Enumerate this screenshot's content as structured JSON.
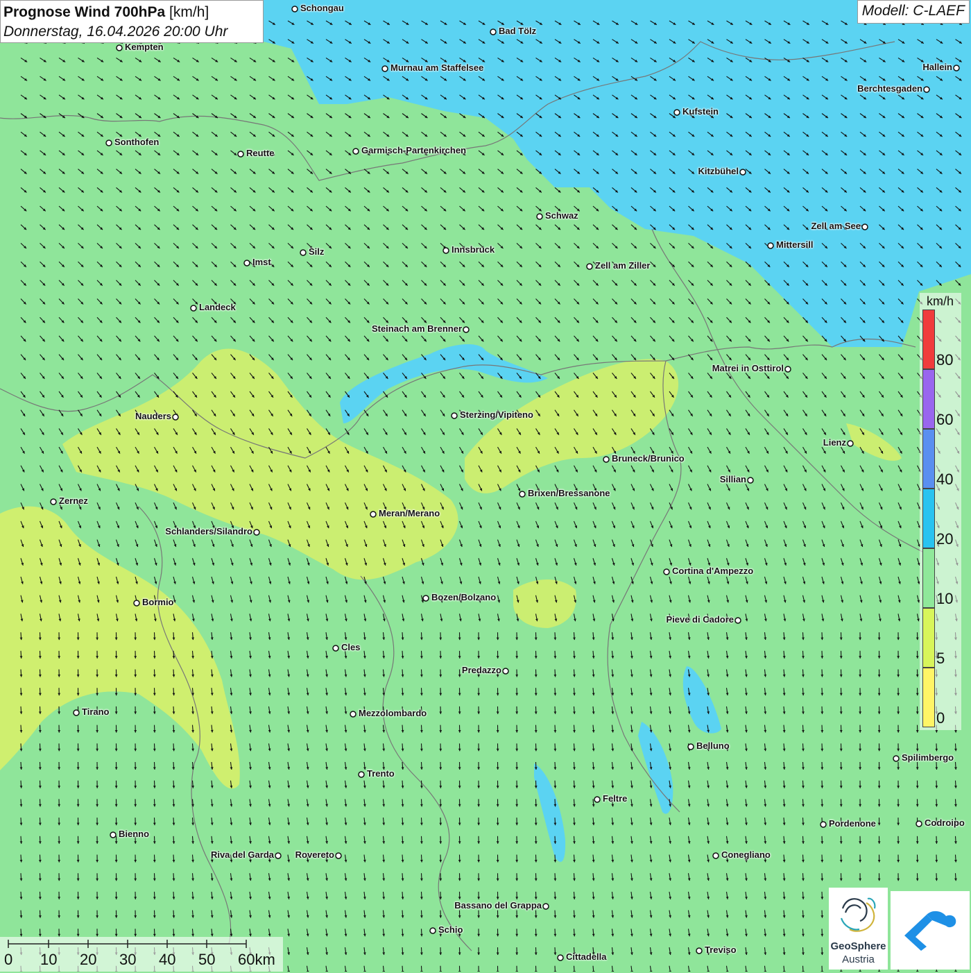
{
  "header": {
    "title_bold": "Prognose Wind 700hPa",
    "title_unit": "[km/h]",
    "datetime": "Donnerstag, 16.04.2026 20:00 Uhr"
  },
  "model": "Modell: C-LAEF",
  "legend": {
    "unit": "km/h",
    "classes": [
      {
        "label": "80",
        "color": "#f03c3c"
      },
      {
        "label": "60",
        "color": "#9966ee"
      },
      {
        "label": "40",
        "color": "#5a8ff0"
      },
      {
        "label": "20",
        "color": "#29c3f0"
      },
      {
        "label": "10",
        "color": "#8fe89a"
      },
      {
        "label": "5",
        "color": "#d8f55a"
      },
      {
        "label": "0",
        "color": "#fff566"
      }
    ]
  },
  "scale_bar": {
    "labels": [
      "0",
      "10",
      "20",
      "30",
      "40",
      "50",
      "60km"
    ]
  },
  "cities": [
    "Schongau",
    "Bad Tölz",
    "Kempten",
    "Murnau am Staffelsee",
    "Hallein",
    "Berchtesgaden",
    "Kufstein",
    "Sonthofen",
    "Reutte",
    "Garmisch-Partenkirchen",
    "Kitzbühel",
    "Schwaz",
    "Zell am See",
    "Mittersill",
    "Innsbruck",
    "Silz",
    "Imst",
    "Zell am Ziller",
    "Landeck",
    "Steinach am Brenner",
    "Matrei in Osttirol",
    "Nauders",
    "Sterzing/Vipiteno",
    "Lienz",
    "Bruneck/Brunico",
    "Sillian",
    "Zernez",
    "Brixen/Bressanone",
    "Meran/Merano",
    "Schlanders/Silandro",
    "Cortina d'Ampezzo",
    "Bozen/Bolzano",
    "Bormio",
    "Pieve di Cadore",
    "Cles",
    "Predazzo",
    "Tirano",
    "Mezzolombardo",
    "Belluno",
    "Spilimbergo",
    "Trento",
    "Feltre",
    "Bienno",
    "Pordenone",
    "Codroipo",
    "Riva del Garda",
    "Rovereto",
    "Conegliano",
    "Bassano del Grappa",
    "Schio",
    "Treviso",
    "Cittadella"
  ],
  "logos": {
    "geosphere_line1": "GeoSphere",
    "geosphere_line2": "Austria"
  },
  "map_features": {
    "wind_arrow_direction": "southeast in north, south in south",
    "colors": {
      "strong_wind_blue": "#5bd3f2",
      "moderate_green": "#8fe59a",
      "weak_yellow": "#d6f06a"
    }
  }
}
